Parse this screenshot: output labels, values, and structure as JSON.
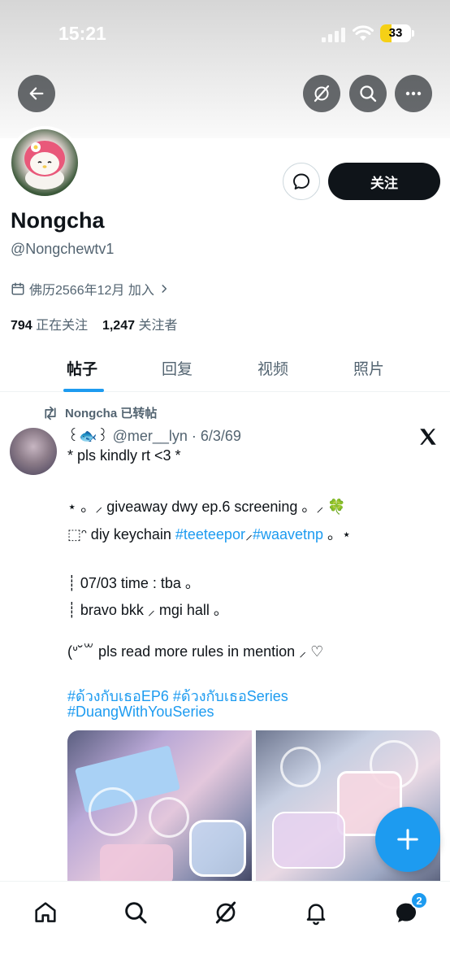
{
  "status_bar": {
    "time": "15:21",
    "battery": "33"
  },
  "profile": {
    "display_name": "Nongcha",
    "handle": "@Nongchewtv1",
    "joined": "佛历2566年12月 加入",
    "following_count": "794",
    "following_label": "正在关注",
    "followers_count": "1,247",
    "followers_label": "关注者",
    "follow_label": "关注"
  },
  "tabs": [
    {
      "label": "帖子",
      "active": true
    },
    {
      "label": "回复",
      "active": false
    },
    {
      "label": "视频",
      "active": false
    },
    {
      "label": "照片",
      "active": false
    }
  ],
  "post": {
    "retweet_text": "Nongcha 已转帖",
    "author_display": "꒰🐟꒱",
    "meta": "@mer__lyn · 6/3/69",
    "line1": "* pls kindly rt <3 *",
    "line2": "⋆   。⸝ giveaway dwy ep.6 screening 。⸝   🍀",
    "line3_prefix": "⬚ᵔ diy keychain",
    "line3_tag1": "#teeteepor",
    "line3_sep": "⸝",
    "line3_tag2": "#waavetnp",
    "line3_suffix": "。⋆",
    "line4": "┊ 07/03 time : tba 。",
    "line5": "┊  bravo bkk ⸝ mgi hall 。",
    "line6": "(ᐡ˘꒳ pls read more rules in mention  ⸝ ♡",
    "hashtags_line1": "#ด้วงกับเธอEP6 #ด้วงกับเธอSeries",
    "hashtags_line2": "#DuangWithYouSeries"
  },
  "nav": {
    "messages_badge": "2"
  },
  "icons": {
    "back": "arrow-left-icon",
    "grok": "grok-icon",
    "search": "search-icon",
    "more": "more-icon",
    "message": "message-icon",
    "calendar": "calendar-icon",
    "retweet": "retweet-icon",
    "x_logo": "x-logo-icon",
    "compose": "plus-icon",
    "home": "home-icon",
    "notifications": "bell-icon",
    "messages": "mail-icon"
  },
  "colors": {
    "accent": "#1d9bf0",
    "text": "#0f1419",
    "secondary": "#536471"
  }
}
